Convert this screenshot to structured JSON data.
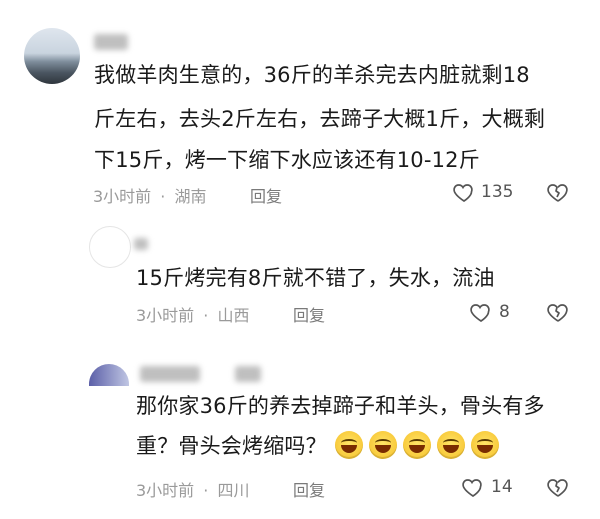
{
  "comments": [
    {
      "text_lines": [
        "我做羊肉生意的，36斤的羊杀完去内脏就剩18",
        "斤左右，去头2斤左右，去蹄子大概1斤，大概剩",
        "下15斤，烤一下缩下水应该还有10-12斤"
      ],
      "time": "3小时前",
      "location": "湖南",
      "reply_label": "回复",
      "likes": "135"
    },
    {
      "text_lines": [
        "15斤烤完有8斤就不错了，失水，流油"
      ],
      "time": "3小时前",
      "location": "山西",
      "reply_label": "回复",
      "likes": "8"
    },
    {
      "text_lines": [
        "那你家36斤的养去掉蹄子和羊头，骨头有多",
        "重？骨头会烤缩吗？"
      ],
      "time": "3小时前",
      "location": "四川",
      "reply_label": "回复",
      "likes": "14",
      "emoji_count": 5
    }
  ],
  "separator": "·",
  "icons": [
    "heart-icon",
    "broken-heart-icon",
    "laughing-emoji-icon"
  ]
}
